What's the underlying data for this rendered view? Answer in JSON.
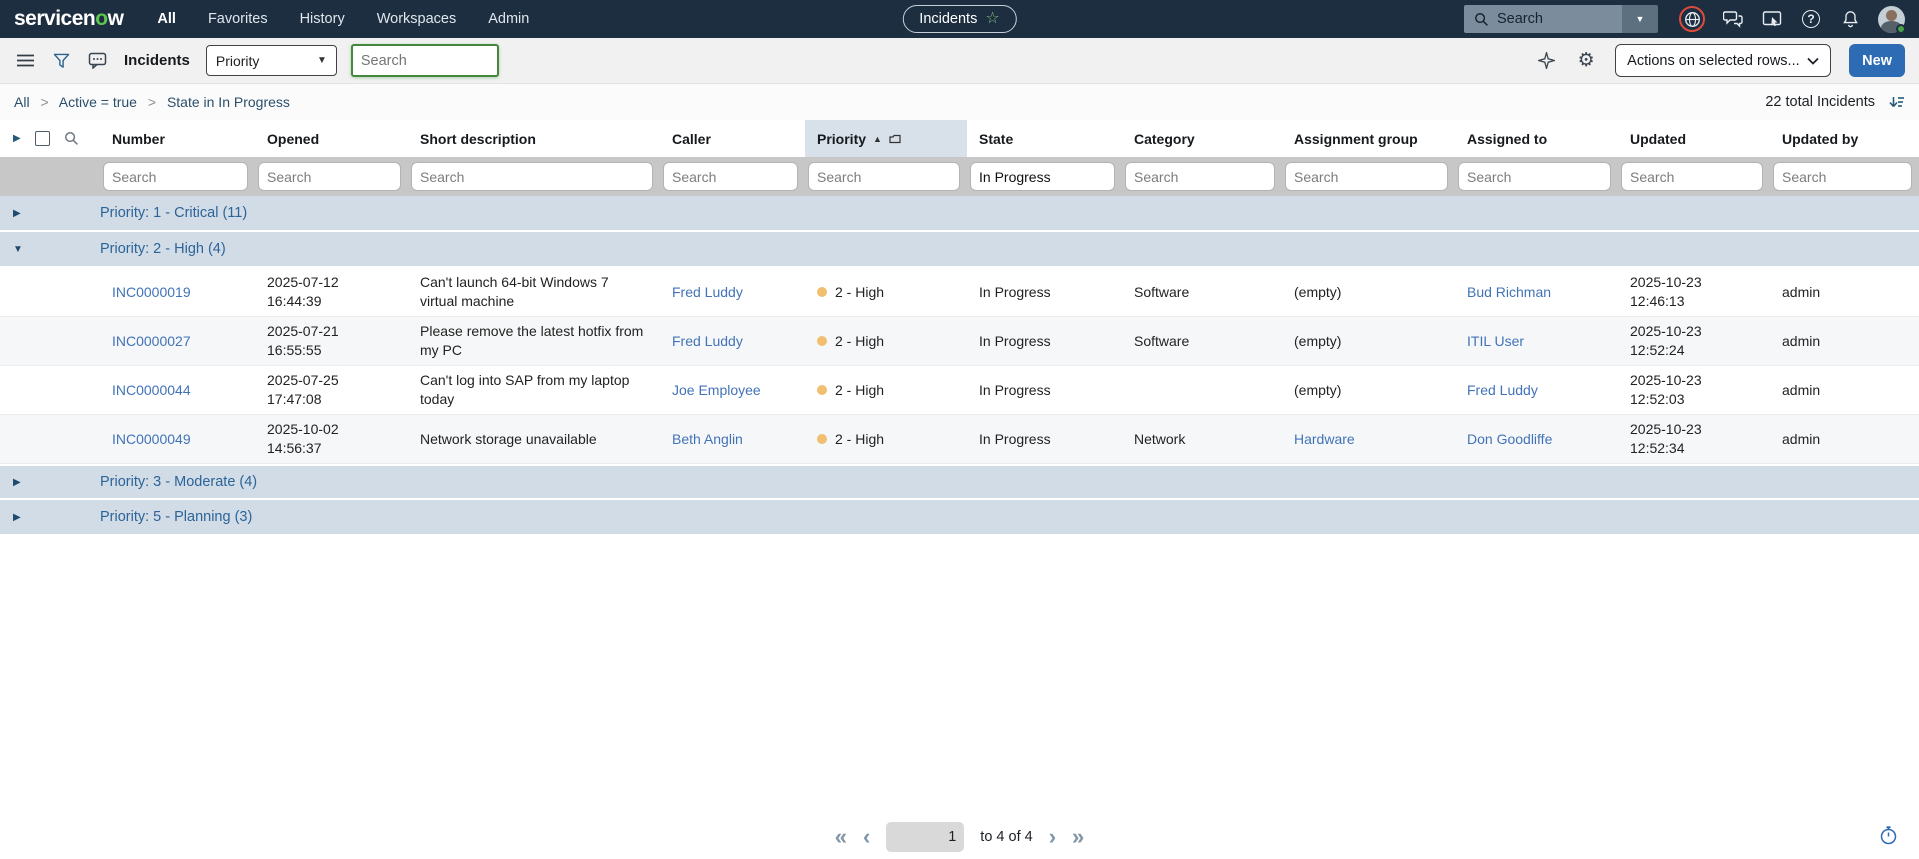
{
  "topnav": {
    "logo_pre": "servicen",
    "logo_o": "o",
    "logo_post": "w",
    "items": [
      {
        "label": "All"
      },
      {
        "label": "Favorites"
      },
      {
        "label": "History"
      },
      {
        "label": "Workspaces"
      },
      {
        "label": "Admin"
      }
    ],
    "context_pill_label": "Incidents",
    "search_placeholder": "Search"
  },
  "toolbar": {
    "title": "Incidents",
    "group_by_value": "Priority",
    "search_placeholder": "Search",
    "actions_select_label": "Actions on selected rows...",
    "new_button_label": "New"
  },
  "breadcrumb": {
    "items": [
      "All",
      "Active = true",
      "State in In Progress"
    ],
    "separator": ">",
    "total_label": "22 total Incidents"
  },
  "table": {
    "columns": [
      "Number",
      "Opened",
      "Short description",
      "Caller",
      "Priority",
      "State",
      "Category",
      "Assignment group",
      "Assigned to",
      "Updated",
      "Updated by"
    ],
    "filter_placeholder": "Search",
    "state_filter_value": "In Progress",
    "groups": [
      {
        "label": "Priority: 1 - Critical (11)",
        "expanded": false
      },
      {
        "label": "Priority: 2 - High (4)",
        "expanded": true
      },
      {
        "label": "Priority: 3 - Moderate (4)",
        "expanded": false
      },
      {
        "label": "Priority: 5 - Planning (3)",
        "expanded": false
      }
    ],
    "rows": [
      {
        "number": "INC0000019",
        "opened": "2025-07-12 16:44:39",
        "short_description": "Can't launch 64-bit Windows 7 virtual machine",
        "caller": "Fred Luddy",
        "priority": "2 - High",
        "state": "In Progress",
        "category": "Software",
        "assignment_group": "(empty)",
        "assigned_to": "Bud Richman",
        "updated": "2025-10-23 12:46:13",
        "updated_by": "admin"
      },
      {
        "number": "INC0000027",
        "opened": "2025-07-21 16:55:55",
        "short_description": "Please remove the latest hotfix from my PC",
        "caller": "Fred Luddy",
        "priority": "2 - High",
        "state": "In Progress",
        "category": "Software",
        "assignment_group": "(empty)",
        "assigned_to": "ITIL User",
        "updated": "2025-10-23 12:52:24",
        "updated_by": "admin"
      },
      {
        "number": "INC0000044",
        "opened": "2025-07-25 17:47:08",
        "short_description": "Can't log into SAP from my laptop today",
        "caller": "Joe Employee",
        "priority": "2 - High",
        "state": "In Progress",
        "category": "",
        "assignment_group": "(empty)",
        "assigned_to": "Fred Luddy",
        "updated": "2025-10-23 12:52:03",
        "updated_by": "admin"
      },
      {
        "number": "INC0000049",
        "opened": "2025-10-02 14:56:37",
        "short_description": "Network storage unavailable",
        "caller": "Beth Anglin",
        "priority": "2 - High",
        "state": "In Progress",
        "category": "Network",
        "assignment_group": "Hardware",
        "assigned_to": "Don Goodliffe",
        "updated": "2025-10-23 12:52:34",
        "updated_by": "admin"
      }
    ]
  },
  "pagination": {
    "page_value": "1",
    "range_text": "to 4 of 4"
  },
  "icons": {
    "star": "☆",
    "gear": "⚙",
    "caret_down": "▼",
    "triangle_right": "▶",
    "triangle_down": "▼",
    "sort_asc": "▲",
    "help": "?",
    "first": "«",
    "prev": "‹",
    "next": "›",
    "last": "»"
  },
  "colors": {
    "topnav_bg": "#1d2e40",
    "logo_green": "#5fc74d",
    "new_button_blue": "#2d6bb5",
    "link_blue": "#4273b8",
    "group_row_bg": "#d2dce6",
    "group_text": "#2c6499",
    "priority_header_highlight": "#d8e1e9",
    "priority_dot": "#f2bf71",
    "filter_row_bg": "#c7c7c7",
    "impersonation_ring_red": "#de4a3c",
    "search_focus_green": "#44883e"
  }
}
